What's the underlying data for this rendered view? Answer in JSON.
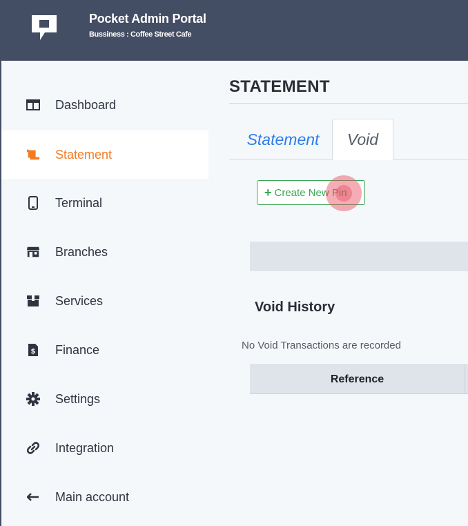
{
  "header": {
    "app_title": "Pocket Admin Portal",
    "business": "Bussiness : Coffee Street Cafe",
    "logo_icon": "pocket-logo-icon"
  },
  "sidebar": {
    "items": [
      {
        "label": "Dashboard",
        "icon": "dashboard-icon",
        "active": false
      },
      {
        "label": "Statement",
        "icon": "scroll-icon",
        "active": true
      },
      {
        "label": "Terminal",
        "icon": "mobile-icon",
        "active": false
      },
      {
        "label": "Branches",
        "icon": "store-icon",
        "active": false
      },
      {
        "label": "Services",
        "icon": "box-icon",
        "active": false
      },
      {
        "label": "Finance",
        "icon": "invoice-icon",
        "active": false
      },
      {
        "label": "Settings",
        "icon": "gear-icon",
        "active": false
      },
      {
        "label": "Integration",
        "icon": "link-icon",
        "active": false
      },
      {
        "label": "Main account",
        "icon": "arrow-left-icon",
        "active": false
      }
    ],
    "accent_color": "#f47a20"
  },
  "main": {
    "page_title": "STATEMENT",
    "tabs": [
      {
        "label": "Statement",
        "active": false
      },
      {
        "label": "Void",
        "active": true
      }
    ],
    "create_button": {
      "label": "Create New Pin",
      "color": "#3aa655"
    },
    "void_history": {
      "title": "Void History",
      "empty_message": "No Void Transactions are recorded",
      "columns": [
        "Reference"
      ]
    }
  }
}
